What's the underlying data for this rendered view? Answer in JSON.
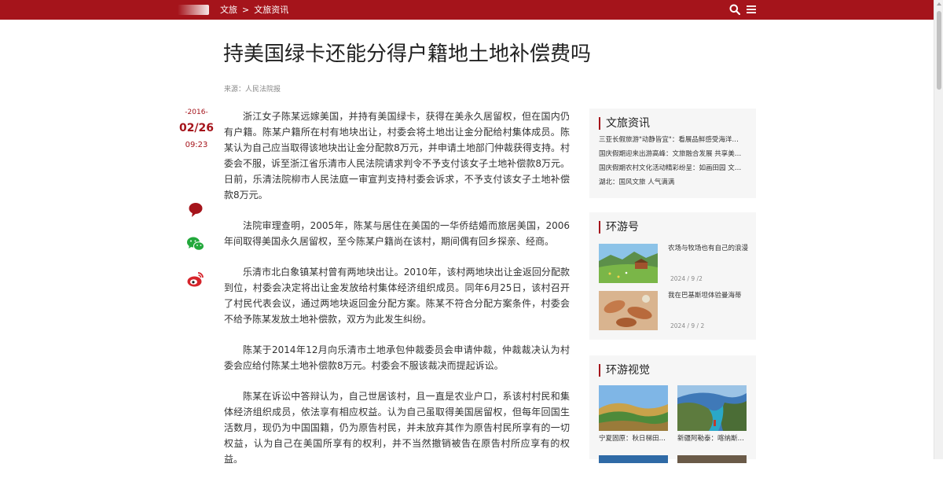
{
  "header": {
    "breadcrumb": [
      "文旅",
      "文旅资讯"
    ],
    "breadcrumb_sep": ">",
    "search_icon": "search-icon",
    "menu_icon": "menu-icon",
    "bar_color": "#a5141b"
  },
  "article": {
    "title": "持美国绿卡还能分得户籍地土地补偿费吗",
    "source": "来源：人民法院报",
    "date_year": "-2016-",
    "date_md": "02/26",
    "date_time": "09:23",
    "paragraphs": [
      "浙江女子陈某远嫁美国，并持有美国绿卡，获得在美永久居留权，但在国内仍有户籍。陈某户籍所在村有地块出让，村委会将土地出让金分配给村集体成员。陈某认为自己应当取得该地块出让金分配款8万元，并申请土地部门仲裁获得支持。村委会不服，诉至浙江省乐清市人民法院请求判令不予支付该女子土地补偿款8万元。日前，乐清法院柳市人民法庭一审宣判支持村委会诉求，不予支付该女子土地补偿款8万元。",
      "法院审理查明，2005年，陈某与居住在美国的一华侨结婚而旅居美国，2006年间取得美国永久居留权，至今陈某户籍尚在该村，期间偶有回乡探亲、经商。",
      "乐清市北白象镇某村曾有两地块出让。2010年，该村两地块出让金返回分配款到位，村委会决定将出让金发放给村集体经济组织成员。同年6月25日，该村召开了村民代表会议，通过两地块返回金分配方案。陈某不符合分配方案条件，村委会不给予陈某发放土地补偿款，双方为此发生纠纷。",
      "陈某于2014年12月向乐清市土地承包仲裁委员会申请仲裁，仲裁裁决认为村委会应给付陈某土地补偿款8万元。村委会不服该裁决而提起诉讼。",
      "陈某在诉讼中答辩认为，自己世居该村，且一直是农业户口，系该村村民和集体经济组织成员，依法享有相应权益。认为自己虽取得美国居留权，但每年回国生活数月，现仍为中国国籍，仍为原告村民，并未放弃其作为原告村民所享有的一切权益，认为自己在美国所享有的权利，并不当然撤销被告在原告村所应享有的权益。"
    ],
    "share_icons": [
      "comment-icon",
      "wechat-icon",
      "weibo-icon"
    ]
  },
  "sidebar": {
    "news": {
      "heading": "文旅资讯",
      "items": [
        "三亚长假旅游\"动静皆宜\"：看展品鲜感受海洋…",
        "国庆假期迎来出游高峰：文旅融合发展 共享美…",
        "国庆假期农村文化活动精彩纷呈：如画田园 文…",
        "湖北：国风文旅 人气满满"
      ]
    },
    "huanyou": {
      "heading": "环游号",
      "items": [
        {
          "title": "农场与牧场也有自己的浪漫",
          "date": "2024 / 9 /2"
        },
        {
          "title": "我在巴基斯坦体验曼海蒂",
          "date": "2024 / 9 / 2"
        }
      ]
    },
    "visual": {
      "heading": "环游视觉",
      "items": [
        "宁夏固原：秋日梯田…",
        "新疆阿勒泰：喀纳斯…"
      ]
    }
  },
  "colors": {
    "accent": "#a5141b",
    "card_bg": "#f6f6f6"
  }
}
